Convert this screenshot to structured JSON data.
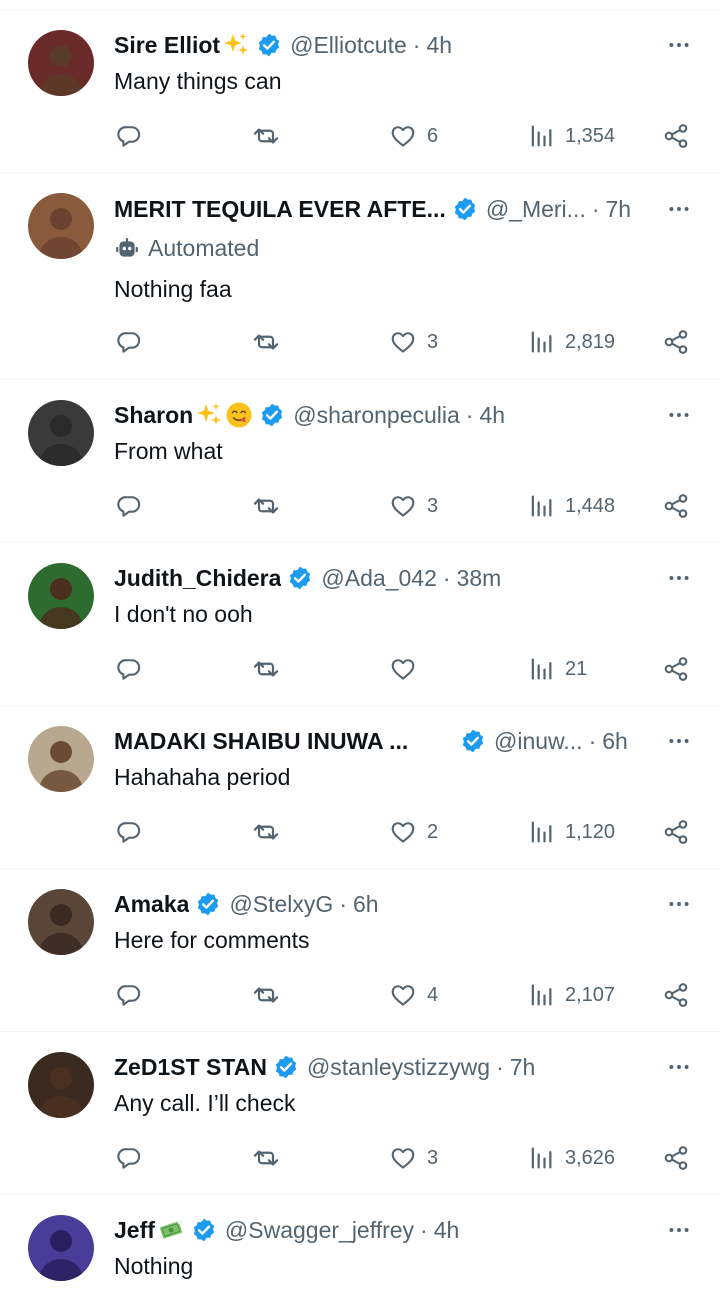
{
  "tweets": [
    {
      "name": "Sire Elliot",
      "emojis": [
        "sparkles"
      ],
      "verified": true,
      "handle": "@Elliotcute",
      "time": "4h",
      "text": "Many things can",
      "automated_label": null,
      "replies": "",
      "retweets": "",
      "likes": "6",
      "views": "1,354",
      "avatar_bg": "#6b2a2a"
    },
    {
      "name": "MERIT TEQUILA EVER AFTE...",
      "emojis": [],
      "verified": true,
      "handle": "@_Meri...",
      "time": "7h",
      "text": "Nothing faa",
      "automated_label": "Automated",
      "replies": "",
      "retweets": "",
      "likes": "3",
      "views": "2,819",
      "avatar_bg": "#8a5a3c"
    },
    {
      "name": "Sharon",
      "emojis": [
        "sparkles",
        "yum"
      ],
      "verified": true,
      "handle": "@sharonpeculia",
      "time": "4h",
      "text": "From what",
      "automated_label": null,
      "replies": "",
      "retweets": "",
      "likes": "3",
      "views": "1,448",
      "avatar_bg": "#3a3a3a"
    },
    {
      "name": "Judith_Chidera",
      "emojis": [],
      "verified": true,
      "handle": "@Ada_042",
      "time": "38m",
      "text": "I don't no ooh",
      "automated_label": null,
      "replies": "",
      "retweets": "",
      "likes": "",
      "views": "21",
      "avatar_bg": "#2e6b2e"
    },
    {
      "name": "MADAKI SHAIBU INUWA ...",
      "emojis": [],
      "verified": true,
      "handle": "@inuw...",
      "time": "6h",
      "text": "Hahahaha period",
      "automated_label": null,
      "replies": "",
      "retweets": "",
      "likes": "2",
      "views": "1,120",
      "avatar_bg": "#b8a890"
    },
    {
      "name": "Amaka",
      "emojis": [],
      "verified": true,
      "handle": "@StelxyG",
      "time": "6h",
      "text": "Here for comments",
      "automated_label": null,
      "replies": "",
      "retweets": "",
      "likes": "4",
      "views": "2,107",
      "avatar_bg": "#5a4638"
    },
    {
      "name": "ZeD1ST STAN",
      "emojis": [],
      "verified": true,
      "handle": "@stanleystizzywg",
      "time": "7h",
      "text": "Any call. I’ll check",
      "automated_label": null,
      "replies": "",
      "retweets": "",
      "likes": "3",
      "views": "3,626",
      "avatar_bg": "#3b2a20"
    },
    {
      "name": "Jeff",
      "emojis": [
        "money-wings"
      ],
      "verified": true,
      "handle": "@Swagger_jeffrey",
      "time": "4h",
      "text": "Nothing",
      "automated_label": null,
      "replies": "",
      "retweets": "",
      "likes": "",
      "views": "",
      "avatar_bg": "#4a3d9a"
    }
  ],
  "colors": {
    "text": "#0f1419",
    "secondary": "#536471",
    "verified": "#1d9bf0",
    "divider": "#eff3f4"
  }
}
